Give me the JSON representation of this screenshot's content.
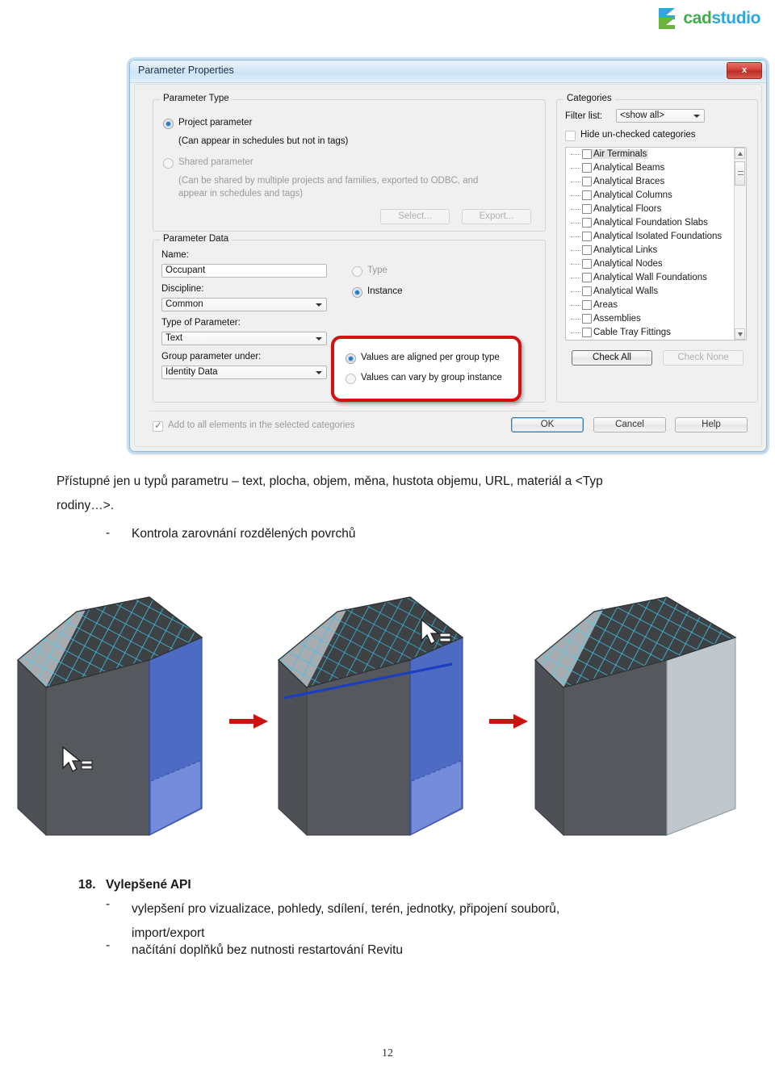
{
  "logo": {
    "cad": "cad",
    "studio": "studio",
    "mark": "cadstudio-logo-mark"
  },
  "dialog": {
    "title": "Parameter Properties",
    "close_label": "x",
    "parameter_type": {
      "legend": "Parameter Type",
      "project_radio": "Project parameter",
      "project_note": "(Can appear in schedules but not in tags)",
      "shared_radio": "Shared parameter",
      "shared_note_line1": "(Can be shared by multiple projects and families, exported to ODBC, and",
      "shared_note_line2": "appear in schedules and tags)",
      "select_button": "Select...",
      "export_button": "Export..."
    },
    "parameter_data": {
      "legend": "Parameter Data",
      "name_label": "Name:",
      "name_value": "Occupant",
      "discipline_label": "Discipline:",
      "discipline_value": "Common",
      "type_of_parameter_label": "Type of Parameter:",
      "type_of_parameter_value": "Text",
      "group_under_label": "Group parameter under:",
      "group_under_value": "Identity Data",
      "type_radio": "Type",
      "instance_radio": "Instance",
      "aligned_radio": "Values are aligned per group type",
      "vary_radio": "Values can vary by group instance"
    },
    "add_all_checkbox": "Add to all elements in the selected categories",
    "categories": {
      "legend": "Categories",
      "filter_label": "Filter list:",
      "filter_value": "<show all>",
      "hide_unchecked": "Hide un-checked categories",
      "items": [
        "Air Terminals",
        "Analytical Beams",
        "Analytical Braces",
        "Analytical Columns",
        "Analytical Floors",
        "Analytical Foundation Slabs",
        "Analytical Isolated Foundations",
        "Analytical Links",
        "Analytical Nodes",
        "Analytical Wall Foundations",
        "Analytical Walls",
        "Areas",
        "Assemblies",
        "Cable Tray Fittings"
      ],
      "check_all": "Check All",
      "check_none": "Check None"
    },
    "ok": "OK",
    "cancel": "Cancel",
    "help": "Help",
    "accent_red": "#d51010",
    "accent_blue": "#2878c0"
  },
  "content": {
    "para1_line1": "Přístupné jen u typů parametru – text, plocha, objem, měna, hustota objemu, URL, materiál a <Typ",
    "para1_line2": "rodiny…>.",
    "bullet_dash": "-",
    "bullet1": "Kontrola zarovnání rozdělených povrchů",
    "section_number": "18.",
    "section_title": "Vylepšené API",
    "bullet2_line1": "vylepšení pro vizualizace, pohledy, sdílení, terén, jednotky, připojení souborů,",
    "bullet2_line2": "import/export",
    "bullet3": "načítání doplňků bez nutnosti restartování Revitu"
  },
  "figure": {
    "caption_alt": "three hexagonal prisms with divided surface grid, arrows between them",
    "grid_color": "#3bc4e8",
    "highlight_blue": "#3f5fc0",
    "arrow_color": "#cc1111"
  },
  "page_number": "12"
}
